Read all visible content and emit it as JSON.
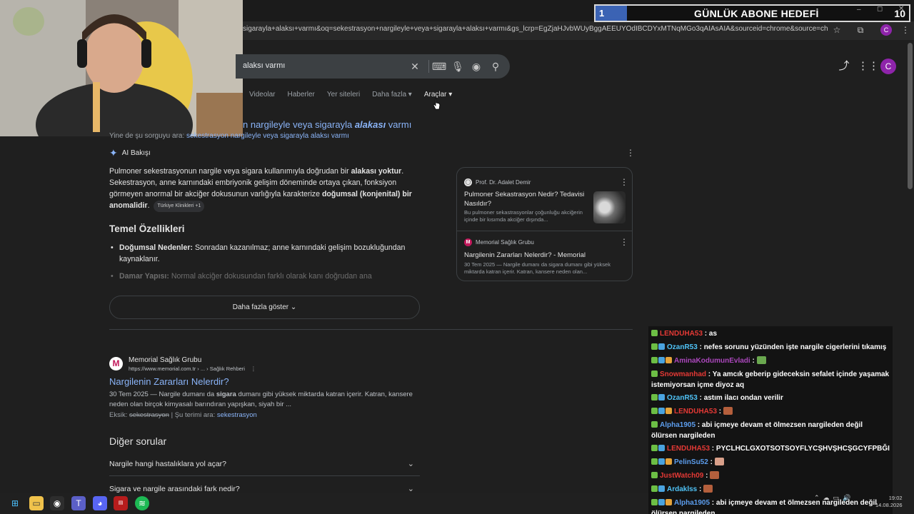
{
  "browser": {
    "url": "sigarayla+alaksı+varmı&oq=sekestrasyon+nargileyle+veya+sigarayla+alaksı+varmı&gs_lcrp=EgZjaHJvbWUyBggAEEUYOdIBCDYxMTNqMGo3qAIAsAIA&sourceid=chrome&source=chrome.ob&ie=U...",
    "profile_initial": "C"
  },
  "overlay_goal": {
    "current": "1",
    "title": "GÜNLÜK ABONE HEDEFİ",
    "target": "10",
    "progress_fraction": 0.1,
    "fill_color": "#3b63b4"
  },
  "search": {
    "query_visible": "alaksı varmı",
    "tabs": [
      "Videolar",
      "Haberler",
      "Yer siteleri",
      "Daha fazla",
      "Araçlar"
    ],
    "active_tab": "Araçlar"
  },
  "correction": {
    "prefix": "n nargileyle veya sigarayla ",
    "bold": "alakası",
    "suffix": " varmı"
  },
  "alt_query": {
    "label": "Yine de şu sorguyu ara:",
    "link": "sekestrasyon nargileyle veya sigarayla alaksı varmı"
  },
  "ai_overview": {
    "label": "AI Bakışı",
    "para": {
      "t1": "Pulmoner sekestrasyonun nargile veya sigara kullanımıyla doğrudan bir ",
      "b1": "alakası yoktur",
      "t2": ". Sekestrasyon, anne karnındaki embriyonik gelişim döneminde ortaya çıkan, fonksiyon görmeyen anormal bir akciğer dokusunun varlığıyla karakterize ",
      "b2": "doğumsal (konjenital) bir anomalidir",
      "t3": ".",
      "chip": "Türkiye Klinikleri +1"
    },
    "section_title": "Temel Özellikleri",
    "bullets": [
      {
        "bold": "Doğumsal Nedenler:",
        "text": " Sonradan kazanılmaz; anne karnındaki gelişim bozukluğundan kaynaklanır."
      },
      {
        "bold": "Damar Yapısı:",
        "text": " Normal akciğer dokusundan farklı olarak kanı doğrudan ana"
      }
    ],
    "show_more": "Daha fazla göster"
  },
  "side_sources": [
    {
      "source": "Prof. Dr. Adalet Demir",
      "title": "Pulmoner Sekastrasyon Nedir? Tedavisi Nasıldır?",
      "snippet": "Bu pulmoner sekastrasyonlar çoğunluğu akciğerin içinde bir kısımda akciğer dışında..."
    },
    {
      "source": "Memorial Sağlık Grubu",
      "title": "Nargilenin Zararları Nelerdir? - Memorial",
      "snippet": "30 Tem 2025 — Nargile dumanı da sigara dumanı gibi yüksek miktarda katran içerir. Katran, kansere neden olan..."
    }
  ],
  "result": {
    "site": "Memorial Sağlık Grubu",
    "url": "https://www.memorial.com.tr › ... › Sağlık Rehberi",
    "title": "Nargilenin Zararları Nelerdir?",
    "snippet_a": "30 Tem 2025 — Nargile dumanı da ",
    "snippet_bold": "sigara",
    "snippet_b": " dumanı gibi yüksek miktarda katran içerir. Katran, kansere neden olan birçok kimyasalı barındıran yapışkan, siyah bir ...",
    "missing_label": "Eksik:",
    "missing_word": "sekestrasyon",
    "must_include": " | Şu terimi ara: ",
    "must_link": "sekestrasyon"
  },
  "faq": {
    "title": "Diğer sorular",
    "questions": [
      "Nargile hangi hastalıklara yol açar?",
      "Sigara ve nargile arasındaki fark nedir?"
    ]
  },
  "chat": [
    {
      "user": "LENDUHA53",
      "color": "#e53935",
      "text": "as",
      "emote": ""
    },
    {
      "user": "OzanR53",
      "color": "#4fc3f7",
      "text": "nefes sorunu yüzünden işte nargile cigerlerini tıkamış",
      "emote": ""
    },
    {
      "user": "AminaKodumunEvladi",
      "color": "#ab47bc",
      "text": "",
      "emote": "#6aa84f"
    },
    {
      "user": "Snowmanhad",
      "color": "#e53935",
      "text": "Ya amcık geberip gideceksin sefalet içinde yaşamak istemiyorsan içme diyoz aq",
      "emote": ""
    },
    {
      "user": "OzanR53",
      "color": "#4fc3f7",
      "text": "astım ilacı ondan verilir",
      "emote": ""
    },
    {
      "user": "LENDUHA53",
      "color": "#e53935",
      "text": "",
      "emote": "#b45f3c"
    },
    {
      "user": "Alpha1905",
      "color": "#5c9ded",
      "text": "abi içmeye devam et ölmezsen nargileden değil ölürsen nargileden",
      "emote": ""
    },
    {
      "user": "LENDUHA53",
      "color": "#e53935",
      "text": "PYCLHCLGXOTSOTSOYFLYCŞHVŞHCŞGCYFPBĞI",
      "emote": ""
    },
    {
      "user": "PelinSu52",
      "color": "#5c9ded",
      "text": "",
      "emote": "#d9a08a"
    },
    {
      "user": "JustWatch09",
      "color": "#e53935",
      "text": "",
      "emote": "#b45f3c"
    },
    {
      "user": "Ardaklss",
      "color": "#4fc3f7",
      "text": "",
      "emote": "#b45f3c"
    },
    {
      "user": "Alpha1905",
      "color": "#5c9ded",
      "text": "abi içmeye devam et ölmezsen nargileden değil ölürsen nargileden",
      "emote": ""
    }
  ],
  "taskbar": {
    "time": "19:02",
    "date": "14.08.2026"
  }
}
